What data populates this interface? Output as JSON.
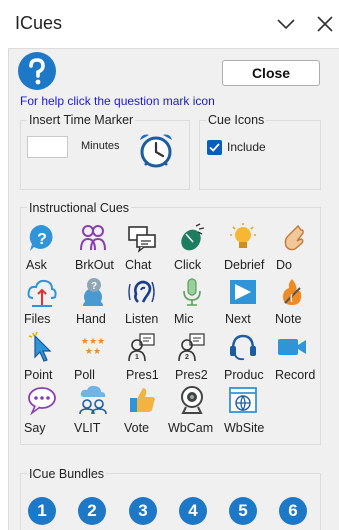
{
  "window": {
    "title": "ICues"
  },
  "header": {
    "close_label": "Close",
    "help_text": "For help click the question mark icon"
  },
  "time_marker": {
    "title": "Insert Time Marker",
    "minutes_value": "",
    "minutes_label": "Minutes"
  },
  "cue_icons": {
    "title": "Cue Icons",
    "include_label": "Include",
    "include_checked": true
  },
  "instructional_cues": {
    "title": "Instructional Cues",
    "items": [
      {
        "label": "Ask",
        "icon": "ask-icon"
      },
      {
        "label": "BrkOut",
        "icon": "breakout-icon"
      },
      {
        "label": "Chat",
        "icon": "chat-icon"
      },
      {
        "label": "Click",
        "icon": "mouse-click-icon"
      },
      {
        "label": "Debrief",
        "icon": "lightbulb-icon"
      },
      {
        "label": "Do",
        "icon": "hand-pointing-icon"
      },
      {
        "label": "Files",
        "icon": "files-icon"
      },
      {
        "label": "Hand",
        "icon": "raise-hand-icon"
      },
      {
        "label": "Listen",
        "icon": "ear-icon"
      },
      {
        "label": "Mic",
        "icon": "microphone-icon"
      },
      {
        "label": "Next",
        "icon": "next-icon"
      },
      {
        "label": "Note",
        "icon": "note-icon"
      },
      {
        "label": "Point",
        "icon": "pointer-icon"
      },
      {
        "label": "Poll",
        "icon": "poll-stars-icon"
      },
      {
        "label": "Pres1",
        "icon": "presenter-1-icon"
      },
      {
        "label": "Pres2",
        "icon": "presenter-2-icon"
      },
      {
        "label": "Produc",
        "icon": "headset-icon"
      },
      {
        "label": "Record",
        "icon": "video-camera-icon"
      },
      {
        "label": "Say",
        "icon": "speech-bubble-icon"
      },
      {
        "label": "VLIT",
        "icon": "vlit-icon"
      },
      {
        "label": "Vote",
        "icon": "thumbs-up-icon"
      },
      {
        "label": "WbCam",
        "icon": "webcam-icon"
      },
      {
        "label": "WbSite",
        "icon": "website-icon"
      }
    ]
  },
  "bundles": {
    "title": "ICue Bundles",
    "items": [
      "1",
      "2",
      "3",
      "4",
      "5",
      "6"
    ]
  },
  "colors": {
    "accent": "#1e78c8",
    "link": "#1a1adc",
    "checkbox": "#0a5cc5",
    "pane": "#f0f0f0"
  }
}
